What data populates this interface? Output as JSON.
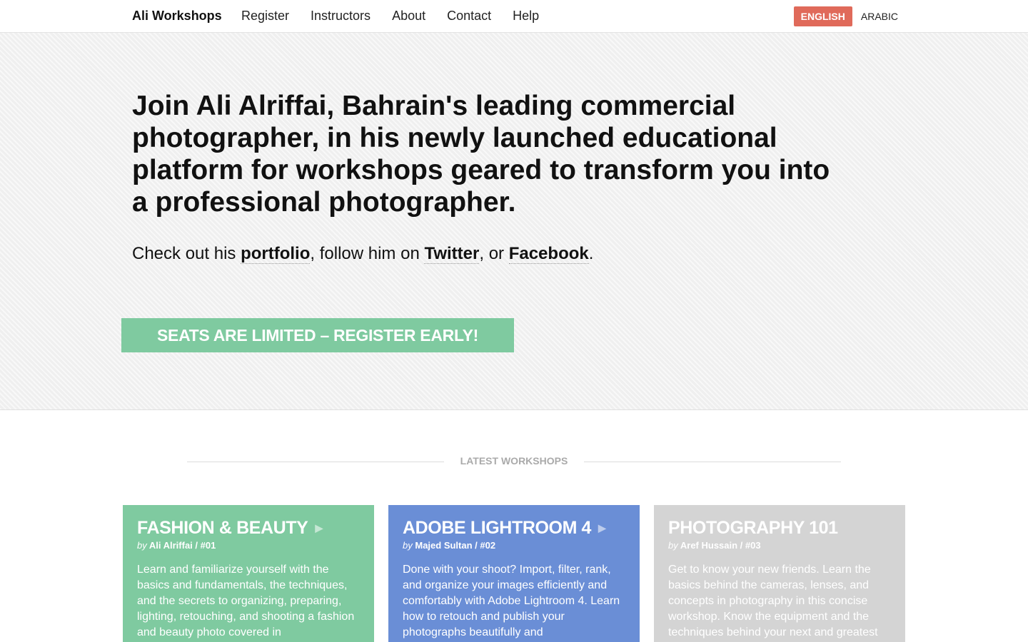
{
  "nav": {
    "brand": "Ali Workshops",
    "items": [
      "Register",
      "Instructors",
      "About",
      "Contact",
      "Help"
    ],
    "lang_english": "ENGLISH",
    "lang_arabic": "ARABIC"
  },
  "hero": {
    "headline_prefix": "Join ",
    "headline_name": "Ali Alriffai",
    "headline_rest": ", Bahrain's leading commercial photographer, in his newly launched educational platform for workshops geared to transform you into a professional photographer.",
    "social_prefix": "Check out his ",
    "portfolio_link": "portfolio",
    "social_mid1": ", follow him on ",
    "twitter_link": "Twitter",
    "social_mid2": ", or ",
    "facebook_link": "Facebook",
    "social_end": ".",
    "cta_label": "SEATS ARE LIMITED – REGISTER EARLY!"
  },
  "section": {
    "title": "LATEST WORKSHOPS"
  },
  "workshops": [
    {
      "title": "FASHION & BEAUTY",
      "by": "by",
      "meta": "Ali Alriffai / #01",
      "desc": "Learn and familiarize yourself with the basics and fundamentals, the techniques, and the secrets to organizing, preparing, lighting, retouching, and shooting a fashion and beauty photo covered in",
      "color": "#7fcaa0"
    },
    {
      "title": "ADOBE LIGHTROOM 4",
      "by": "by",
      "meta": "Majed Sultan / #02",
      "desc": "Done with your shoot? Import, filter, rank, and organize your images efficiently and comfortably with Adobe Lightroom 4. Learn how to retouch and publish your photographs beautifully and",
      "color": "#6a8ed6"
    },
    {
      "title": "PHOTOGRAPHY 101",
      "by": "by",
      "meta": "Aref Hussain / #03",
      "desc": "Get to know your new friends. Learn the basics behind the cameras, lenses, and concepts in photography in this concise workshop. Know the equipment and the techniques behind your next and greatest",
      "color": "#d4d4d4"
    }
  ],
  "icons": {
    "card_arrow": "play-arrow-icon"
  }
}
